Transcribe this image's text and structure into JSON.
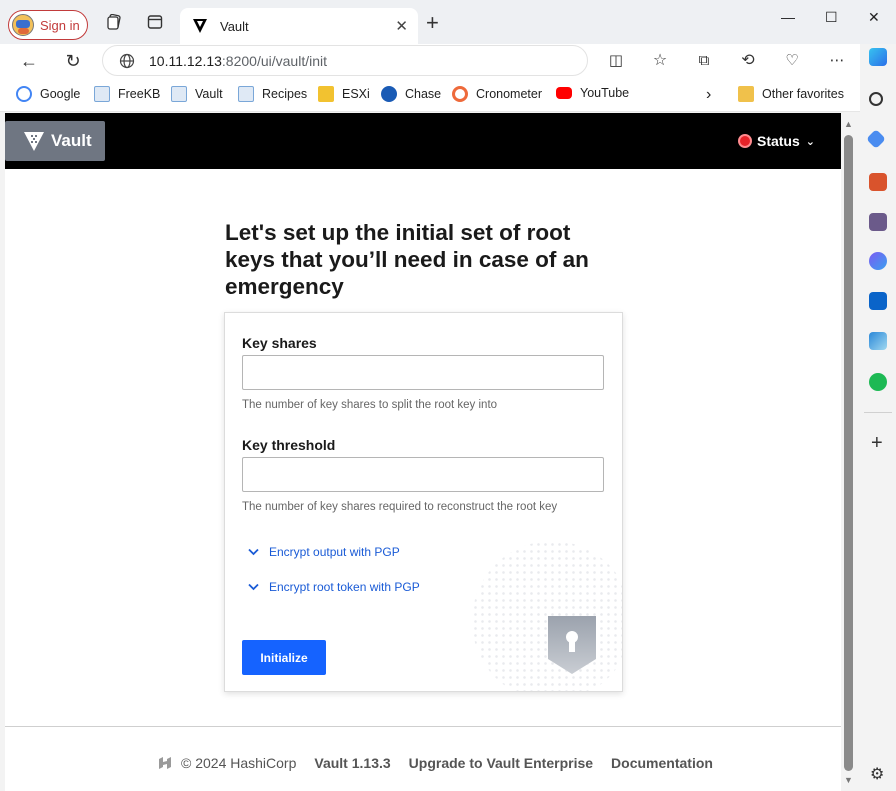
{
  "browser": {
    "signin_label": "Sign in",
    "tab_title": "Vault",
    "url_host": "10.11.12.13",
    "url_path": ":8200/ui/vault/init",
    "favorites": [
      {
        "label": "Google",
        "color": "#4285f4"
      },
      {
        "label": "FreeKB",
        "color": "#7aa7d8"
      },
      {
        "label": "Vault",
        "color": "#7aa7d8"
      },
      {
        "label": "Recipes",
        "color": "#7aa7d8"
      },
      {
        "label": "ESXi",
        "color": "#f2c230"
      },
      {
        "label": "Chase",
        "color": "#1a5bb5"
      },
      {
        "label": "Cronometer",
        "color": "#ee6a3b"
      },
      {
        "label": "YouTube",
        "color": "#ff0000"
      }
    ],
    "other_favorites": "Other favorites"
  },
  "vault": {
    "logo_text": "Vault",
    "status_label": "Status",
    "heading": "Let's set up the initial set of root keys that you’ll need in case of an emergency",
    "key_shares": {
      "label": "Key shares",
      "value": "",
      "help": "The number of key shares to split the root key into"
    },
    "key_threshold": {
      "label": "Key threshold",
      "value": "",
      "help": "The number of key shares required to reconstruct the root key"
    },
    "toggle_output_pgp": "Encrypt output with PGP",
    "toggle_root_pgp": "Encrypt root token with PGP",
    "initialize_button": "Initialize",
    "footer": {
      "copyright": "© 2024 HashiCorp",
      "version": "Vault 1.13.3",
      "upgrade": "Upgrade to Vault Enterprise",
      "docs": "Documentation"
    }
  },
  "colors": {
    "primary_blue": "#1563ff",
    "status_red": "#e52228",
    "header_bg": "#000000"
  }
}
